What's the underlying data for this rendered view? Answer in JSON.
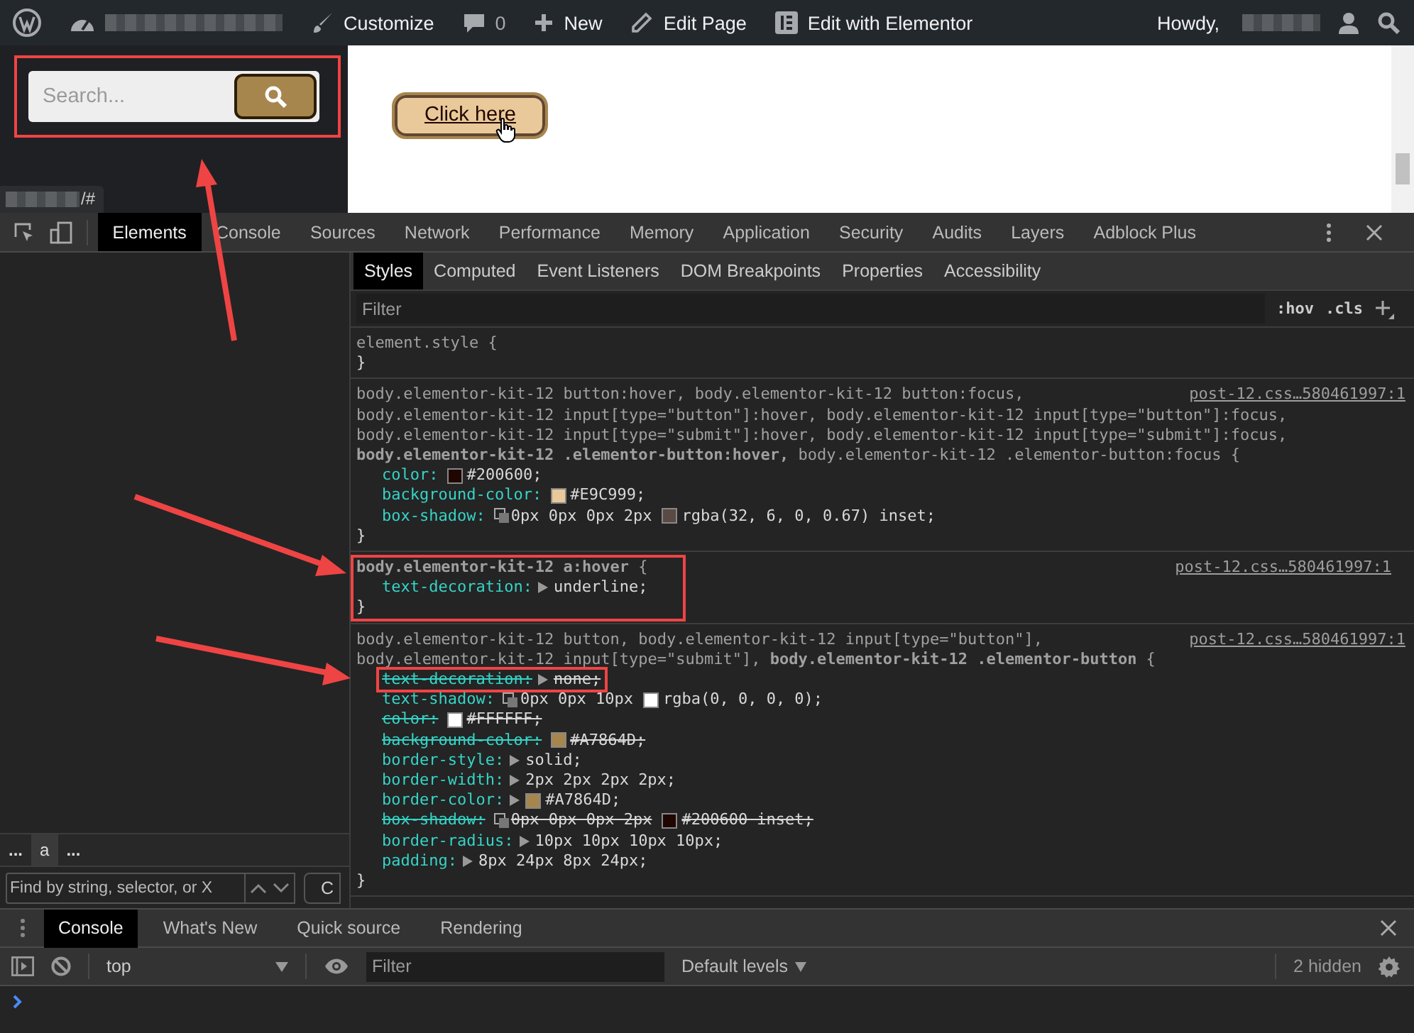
{
  "admin_bar": {
    "items": [
      {
        "kind": "wordpress"
      },
      {
        "kind": "dashboard",
        "redacted": true
      },
      {
        "kind": "brush",
        "label": "Customize"
      },
      {
        "kind": "comments",
        "label": "0"
      },
      {
        "kind": "plus",
        "label": "New"
      },
      {
        "kind": "pencil",
        "label": "Edit Page"
      },
      {
        "kind": "elementor",
        "label": "Edit with Elementor"
      }
    ],
    "greeting": "Howdy,",
    "user_redacted": true
  },
  "page": {
    "search": {
      "placeholder": "Search...",
      "annotated": true
    },
    "button": {
      "label": "Click here",
      "hovered": true
    },
    "status_url": {
      "redacted": true,
      "text": "/#"
    }
  },
  "devtools": {
    "tabs": [
      {
        "label": "Elements",
        "selected": true
      },
      {
        "label": "Console",
        "selected": false
      },
      {
        "label": "Sources",
        "selected": false
      },
      {
        "label": "Network",
        "selected": false
      },
      {
        "label": "Performance",
        "selected": false
      },
      {
        "label": "Memory",
        "selected": false
      },
      {
        "label": "Application",
        "selected": false
      },
      {
        "label": "Security",
        "selected": false
      },
      {
        "label": "Audits",
        "selected": false
      },
      {
        "label": "Layers",
        "selected": false
      },
      {
        "label": "Adblock Plus",
        "selected": false
      }
    ],
    "breadcrumb": [
      {
        "label": "...",
        "selected": false
      },
      {
        "label": "a",
        "selected": true
      },
      {
        "label": "...",
        "selected": false
      }
    ],
    "find": {
      "placeholder": "Find by string, selector, or X",
      "cancel": "C"
    },
    "styles_tabs": [
      {
        "label": "Styles",
        "selected": true
      },
      {
        "label": "Computed",
        "selected": false
      },
      {
        "label": "Event Listeners",
        "selected": false
      },
      {
        "label": "DOM Breakpoints",
        "selected": false
      },
      {
        "label": "Properties",
        "selected": false
      },
      {
        "label": "Accessibility",
        "selected": false
      }
    ],
    "filter": {
      "placeholder": "Filter",
      "hov": ":hov",
      "cls": ".cls"
    },
    "rules": [
      {
        "selector": [
          "element.style {"
        ],
        "annotated": false,
        "closing": "}"
      },
      {
        "selector": [
          "body.elementor-kit-12 button:hover, body.elementor-kit-12 button:focus,",
          "body.elementor-kit-12 input[type=\"button\"]:hover, body.elementor-kit-12 input[type=\"button\"]:focus,",
          "body.elementor-kit-12 input[type=\"submit\"]:hover, body.elementor-kit-12 input[type=\"submit\"]:focus,",
          "**body.elementor-kit-12 .elementor-button:hover,** body.elementor-kit-12 .elementor-button:focus {"
        ],
        "annotated": false,
        "source": "post-12.css…580461997:1",
        "properties": [
          {
            "name": "color:",
            "overridden": false,
            "annotated": false,
            "parts": [
              {
                "kind": "swatch",
                "color": "#200600"
              },
              {
                "kind": "text",
                "text": "#200600;"
              }
            ]
          },
          {
            "name": "background-color:",
            "overridden": false,
            "annotated": false,
            "parts": [
              {
                "kind": "swatch",
                "color": "#e9c999"
              },
              {
                "kind": "text",
                "text": "#E9C999;"
              }
            ]
          },
          {
            "name": "box-shadow:",
            "overridden": false,
            "annotated": false,
            "parts": [
              {
                "kind": "shadow"
              },
              {
                "kind": "text",
                "text": "0px 0px 0px 2px"
              },
              {
                "kind": "swatch",
                "color": "#5a4a44"
              },
              {
                "kind": "text",
                "text": "rgba(32, 6, 0, 0.67) inset;"
              }
            ]
          }
        ],
        "closing": "}"
      },
      {
        "selector": [
          "**body.elementor-kit-12 a:hover** {"
        ],
        "annotated": true,
        "source": "post-12.css…580461997:1",
        "properties": [
          {
            "name": "text-decoration:",
            "overridden": false,
            "annotated": false,
            "parts": [
              {
                "kind": "toggle"
              },
              {
                "kind": "text",
                "text": "underline;"
              }
            ]
          }
        ],
        "closing": "}"
      },
      {
        "selector": [
          "body.elementor-kit-12 button, body.elementor-kit-12 input[type=\"button\"],",
          "body.elementor-kit-12 input[type=\"submit\"], **body.elementor-kit-12 .elementor-button** {"
        ],
        "annotated": false,
        "source": "post-12.css…580461997:1",
        "properties": [
          {
            "name": "text-decoration:",
            "overridden": true,
            "annotated": true,
            "parts": [
              {
                "kind": "toggle"
              },
              {
                "kind": "text",
                "text": "none;"
              }
            ]
          },
          {
            "name": "text-shadow:",
            "overridden": false,
            "annotated": false,
            "parts": [
              {
                "kind": "shadow"
              },
              {
                "kind": "text",
                "text": "0px 0px 10px"
              },
              {
                "kind": "swatch",
                "color": "#ffffff"
              },
              {
                "kind": "text",
                "text": "rgba(0, 0, 0, 0);"
              }
            ]
          },
          {
            "name": "color:",
            "overridden": true,
            "annotated": false,
            "parts": [
              {
                "kind": "swatch",
                "color": "#ffffff"
              },
              {
                "kind": "text",
                "text": "#FFFFFF;"
              }
            ]
          },
          {
            "name": "background-color:",
            "overridden": true,
            "annotated": false,
            "parts": [
              {
                "kind": "swatch",
                "color": "#a7864d"
              },
              {
                "kind": "text",
                "text": "#A7864D;"
              }
            ]
          },
          {
            "name": "border-style:",
            "overridden": false,
            "annotated": false,
            "parts": [
              {
                "kind": "toggle"
              },
              {
                "kind": "text",
                "text": "solid;"
              }
            ]
          },
          {
            "name": "border-width:",
            "overridden": false,
            "annotated": false,
            "parts": [
              {
                "kind": "toggle"
              },
              {
                "kind": "text",
                "text": "2px 2px 2px 2px;"
              }
            ]
          },
          {
            "name": "border-color:",
            "overridden": false,
            "annotated": false,
            "parts": [
              {
                "kind": "toggle"
              },
              {
                "kind": "swatch",
                "color": "#a7864d"
              },
              {
                "kind": "text",
                "text": "#A7864D;"
              }
            ]
          },
          {
            "name": "box-shadow:",
            "overridden": true,
            "annotated": false,
            "parts": [
              {
                "kind": "shadow"
              },
              {
                "kind": "text",
                "text": "0px 0px 0px 2px"
              },
              {
                "kind": "swatch",
                "color": "#200600"
              },
              {
                "kind": "text",
                "text": "#200600 inset;"
              }
            ]
          },
          {
            "name": "border-radius:",
            "overridden": false,
            "annotated": false,
            "parts": [
              {
                "kind": "toggle"
              },
              {
                "kind": "text",
                "text": "10px 10px 10px 10px;"
              }
            ]
          },
          {
            "name": "padding:",
            "overridden": false,
            "annotated": false,
            "parts": [
              {
                "kind": "toggle"
              },
              {
                "kind": "text",
                "text": "8px 24px 8px 24px;"
              }
            ]
          }
        ],
        "closing": "}"
      }
    ]
  },
  "drawer": {
    "tabs": [
      {
        "label": "Console",
        "selected": true
      },
      {
        "label": "What's New",
        "selected": false
      },
      {
        "label": "Quick source",
        "selected": false
      },
      {
        "label": "Rendering",
        "selected": false
      }
    ],
    "context": "top",
    "filter_placeholder": "Filter",
    "levels": "Default levels",
    "hidden_count": "2 hidden"
  }
}
